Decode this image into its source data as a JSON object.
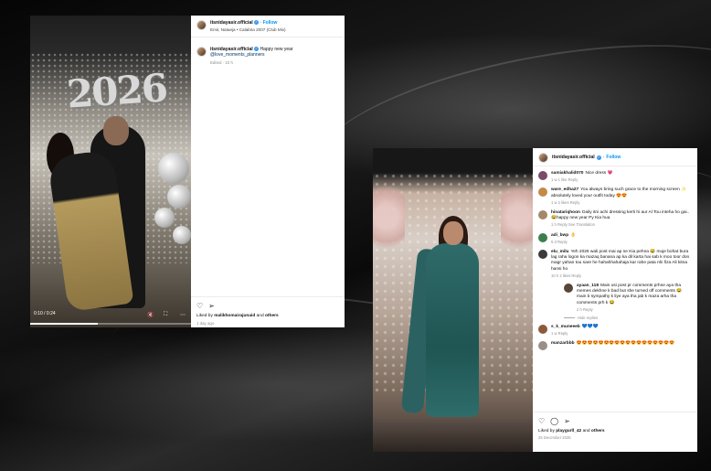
{
  "post1": {
    "username": "itsnidayasir.official",
    "follow": "Follow",
    "audio": "Emir, Nataeja • Calabria 2007 (Club Mix)",
    "caption_user": "itsnidayasir.official",
    "caption_text": "Happy new year",
    "caption_mention": "@love_moments_planners",
    "edited": "Edited · 10 h",
    "video_time": "0:10 / 0:24",
    "video_progress": 0.42,
    "likes_prefix": "Liked by",
    "likes_user": "malikhomairajunaid",
    "likes_suffix": "and",
    "likes_others": "others",
    "date": "1 day ago",
    "photo_text": "2026"
  },
  "post2": {
    "username": "itsnidayasir.official",
    "follow": "Follow",
    "comments": [
      {
        "user": "samiakhalid070",
        "text": "Nice dress 💗",
        "meta": "1 w   1 like   Reply",
        "avatar_color": "#7a4b6b"
      },
      {
        "user": "ware_edha27",
        "text": "You always bring such grace to the morning screen ✨ absolutely loved your outfit today 😍😍",
        "meta": "1 w   2 likes   Reply",
        "avatar_color": "#c48a4a"
      },
      {
        "user": "hinatariqhoon",
        "text": "Daily itni achi dressing kerti hi aur Al Tou inteha ho gai.. 😂happy new year Py Kia hua",
        "meta": "1 h   Reply   See Translation",
        "avatar_color": "#a3886b"
      },
      {
        "user": "adi_bwp",
        "text": "👌",
        "meta": "5 d   Reply",
        "avatar_color": "#3c7f4e"
      },
      {
        "user": "elu_milu",
        "text": "Yeh 2026 wali post mai ap ne Kia pehna 😂 muje bohat bura lag raha logon ka mazaq banana ap ka dil karta hai sab k moo toor don magr yahan tou sare he hahahhahahaja kar rahe pata nhi fiza Ali kitna hansi ho",
        "meta": "10 h   2 likes   Reply",
        "avatar_color": "#3a3a3a"
      }
    ],
    "reply": {
      "user": "ayaan_118",
      "text": "Main usi post pr comments prhne aya tha memes dekhne k bad but she turned off comments 😂 main b sympathy k liye aya tha jab k maza arha tha comments prh k 😂",
      "meta": "2 h   Reply",
      "avatar_color": "#5a4636"
    },
    "hide_replies": "Hide replies",
    "comments_after": [
      {
        "user": "s_k_muneeeb",
        "text": "💙💙💙",
        "meta": "1 w   Reply",
        "avatar_color": "#8c5a3a"
      },
      {
        "user": "manzarbbb",
        "text": "😍😍😍😍😍😍😍😍😍😍😍😍😍😍😍😍😍😍",
        "meta": "",
        "avatar_color": "#9a8f86"
      }
    ],
    "likes_prefix": "Liked by",
    "likes_user": "playgurll_42",
    "likes_suffix": "and",
    "likes_others": "others",
    "date": "25 December 2025"
  }
}
